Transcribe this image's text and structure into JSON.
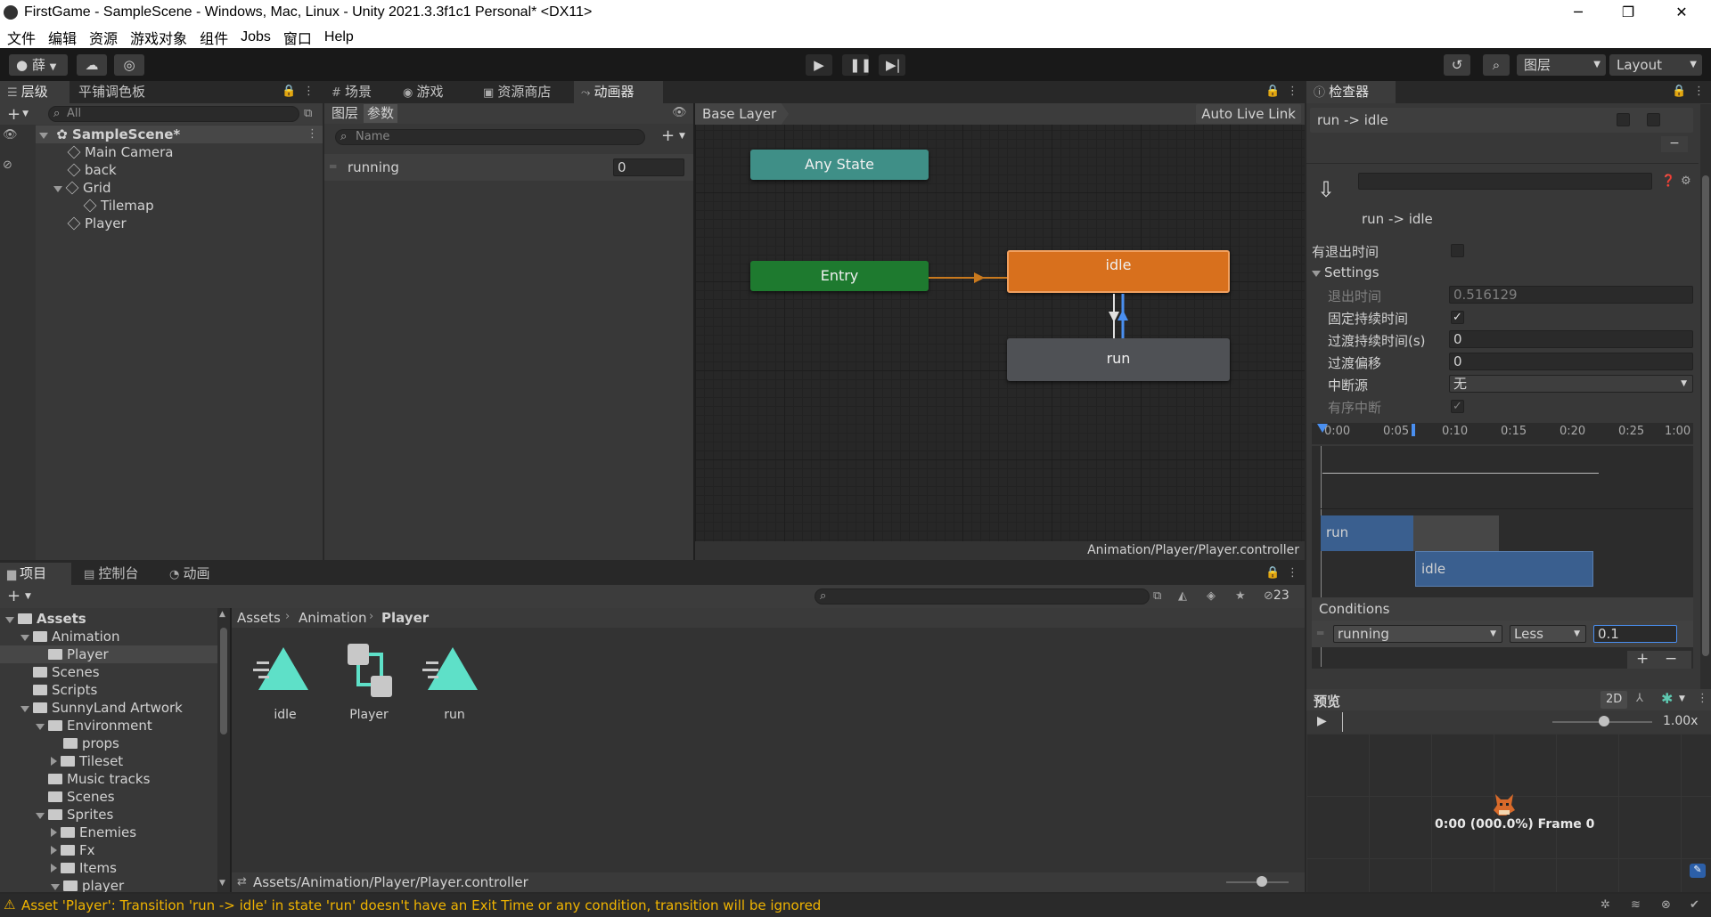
{
  "window": {
    "title": "FirstGame - SampleScene - Windows, Mac, Linux - Unity 2021.3.3f1c1 Personal* <DX11>",
    "minimize": "─",
    "restore": "❐",
    "close": "✕"
  },
  "menu": [
    "文件",
    "编辑",
    "资源",
    "游戏对象",
    "组件",
    "Jobs",
    "窗口",
    "Help"
  ],
  "toolbar": {
    "account": "薛",
    "layers": "图层",
    "layout": "Layout"
  },
  "hierarchy": {
    "tabs": [
      "层级",
      "平铺调色板"
    ],
    "search_placeholder": "All",
    "scene": "SampleScene*",
    "items": [
      "Main Camera",
      "back",
      "Grid",
      "Tilemap",
      "Player"
    ]
  },
  "center_tabs": [
    "场景",
    "游戏",
    "资源商店",
    "动画器"
  ],
  "animator": {
    "subtabs": [
      "图层",
      "参数"
    ],
    "search_placeholder": "Name",
    "param_name": "running",
    "param_value": "0",
    "breadcrumb": "Base Layer",
    "auto_live_link": "Auto Live Link",
    "states": {
      "any": "Any State",
      "entry": "Entry",
      "idle": "idle",
      "run": "run"
    },
    "path": "Animation/Player/Player.controller"
  },
  "inspector": {
    "tab": "检查器",
    "header": "run -> idle",
    "transition_name": "run -> idle",
    "has_exit_time_label": "有退出时间",
    "settings_label": "Settings",
    "exit_time_label": "退出时间",
    "exit_time_value": "0.516129",
    "fixed_duration_label": "固定持续时间",
    "duration_label": "过渡持续时间(s)",
    "duration_value": "0",
    "offset_label": "过渡偏移",
    "offset_value": "0",
    "interrupt_label": "中断源",
    "interrupt_value": "无",
    "ordered_label": "有序中断",
    "timeline_ticks": [
      "0:00",
      "0:05",
      "0:10",
      "0:15",
      "0:20",
      "0:25",
      "1:00"
    ],
    "clip_run": "run",
    "clip_idle": "idle",
    "conditions_label": "Conditions",
    "cond_param": "running",
    "cond_op": "Less",
    "cond_value": "0.1",
    "add": "+",
    "remove": "−"
  },
  "preview": {
    "label": "预览",
    "mode_2d": "2D",
    "speed": "1.00x",
    "frame": "0:00 (000.0%) Frame 0"
  },
  "bottom_tabs": [
    "项目",
    "控制台",
    "动画"
  ],
  "project": {
    "tree": [
      {
        "label": "Assets",
        "depth": 0,
        "type": "open",
        "bold": true
      },
      {
        "label": "Animation",
        "depth": 1,
        "type": "open"
      },
      {
        "label": "Player",
        "depth": 2,
        "type": "leaf",
        "selected": true
      },
      {
        "label": "Scenes",
        "depth": 1,
        "type": "leaf"
      },
      {
        "label": "Scripts",
        "depth": 1,
        "type": "leaf"
      },
      {
        "label": "SunnyLand Artwork",
        "depth": 1,
        "type": "open"
      },
      {
        "label": "Environment",
        "depth": 2,
        "type": "open"
      },
      {
        "label": "props",
        "depth": 3,
        "type": "leaf"
      },
      {
        "label": "Tileset",
        "depth": 3,
        "type": "closed"
      },
      {
        "label": "Music tracks",
        "depth": 2,
        "type": "leaf"
      },
      {
        "label": "Scenes",
        "depth": 2,
        "type": "leaf"
      },
      {
        "label": "Sprites",
        "depth": 2,
        "type": "open"
      },
      {
        "label": "Enemies",
        "depth": 3,
        "type": "closed"
      },
      {
        "label": "Fx",
        "depth": 3,
        "type": "closed"
      },
      {
        "label": "Items",
        "depth": 3,
        "type": "closed"
      },
      {
        "label": "player",
        "depth": 3,
        "type": "open"
      }
    ],
    "breadcrumb": [
      "Assets",
      "Animation",
      "Player"
    ],
    "hidden_count": "23",
    "assets": [
      "idle",
      "Player",
      "run"
    ],
    "footer_path": "Assets/Animation/Player/Player.controller"
  },
  "status": {
    "message": "Asset 'Player': Transition 'run -> idle' in state 'run' doesn't have an Exit Time or any condition, transition will be ignored"
  },
  "colors": {
    "any_state": "#3f8f87",
    "entry": "#1e7a2f",
    "idle": "#d8701d",
    "run": "#4f5155",
    "clip": "#3a5f8f"
  }
}
